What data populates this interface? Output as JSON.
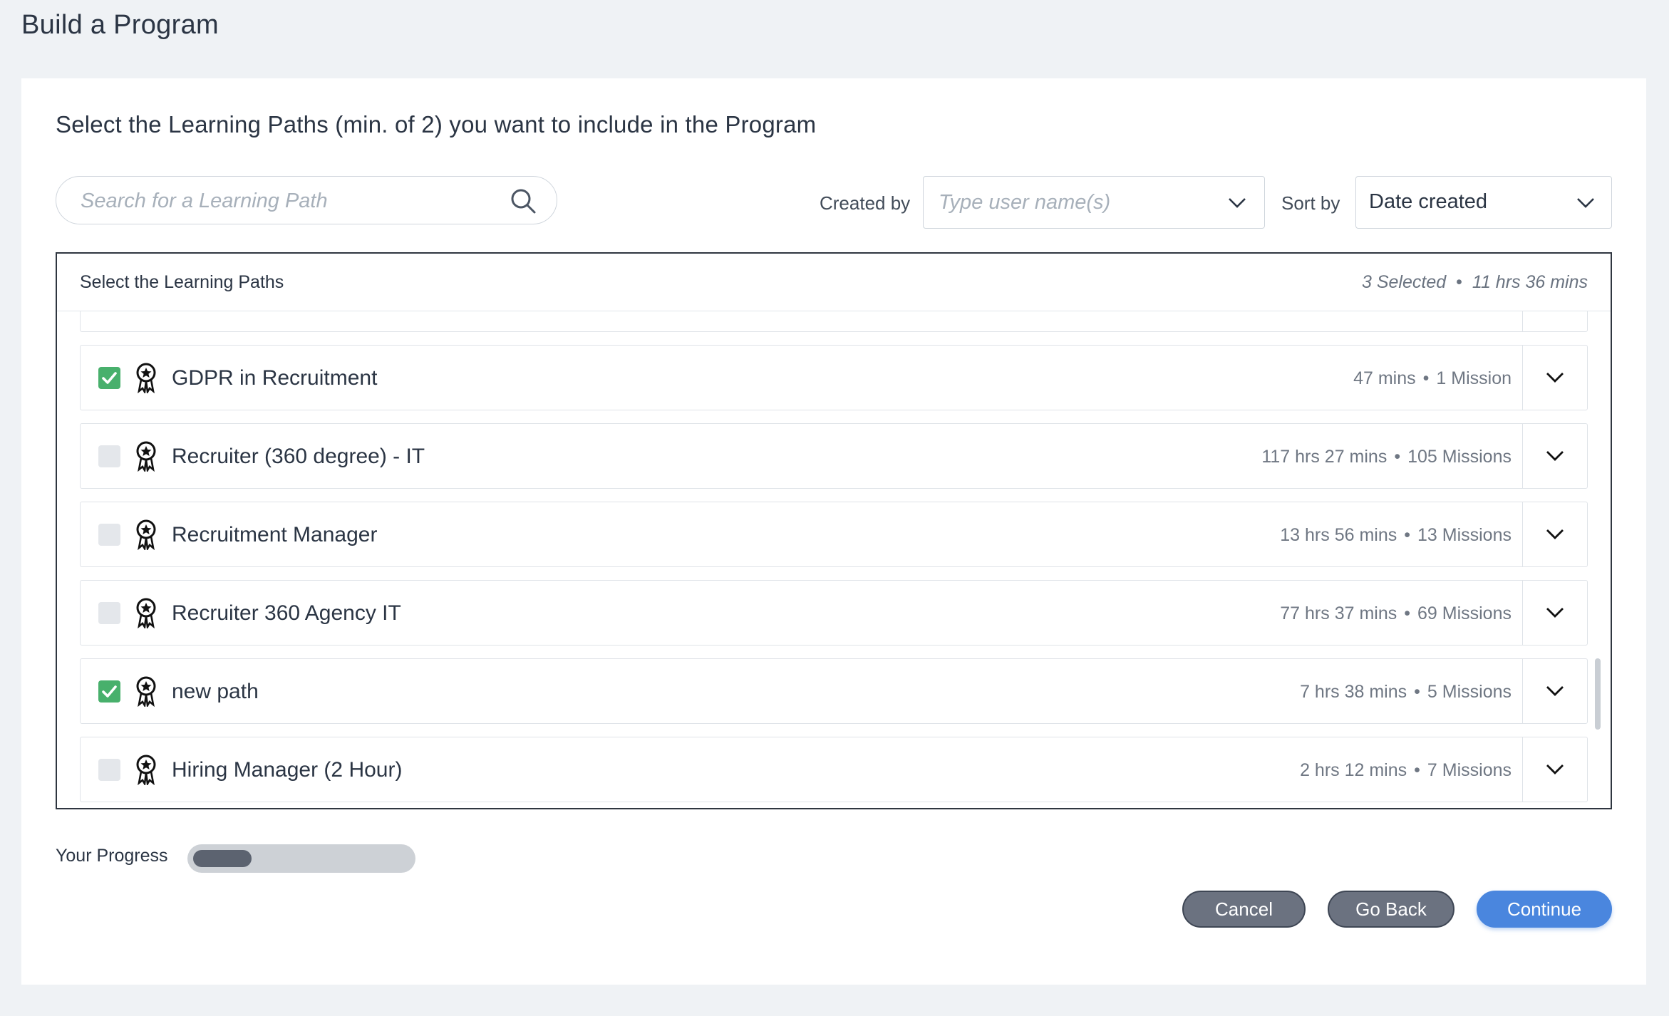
{
  "page": {
    "title": "Build a Program"
  },
  "card": {
    "instructions": "Select the Learning Paths (min. of 2) you want to include in the Program"
  },
  "filters": {
    "search_placeholder": "Search for a Learning Path",
    "created_by_label": "Created by",
    "created_by_placeholder": "Type user name(s)",
    "sort_by_label": "Sort by",
    "sort_by_value": "Date created"
  },
  "panel": {
    "title": "Select the Learning Paths",
    "selected_count": "3 Selected",
    "dot": "•",
    "total_time": "11 hrs 36 mins"
  },
  "paths": [
    {
      "name": "GDPR in Recruitment",
      "duration": "47 mins",
      "missions": "1 Mission",
      "checked": true
    },
    {
      "name": "Recruiter (360 degree) - IT",
      "duration": "117 hrs 27 mins",
      "missions": "105 Missions",
      "checked": false
    },
    {
      "name": "Recruitment Manager",
      "duration": "13 hrs 56 mins",
      "missions": "13 Missions",
      "checked": false
    },
    {
      "name": "Recruiter 360 Agency IT",
      "duration": "77 hrs 37 mins",
      "missions": "69 Missions",
      "checked": false
    },
    {
      "name": "new path",
      "duration": "7 hrs 38 mins",
      "missions": "5 Missions",
      "checked": true
    },
    {
      "name": "Hiring Manager (2 Hour)",
      "duration": "2 hrs 12 mins",
      "missions": "7 Missions",
      "checked": false
    }
  ],
  "meta_separator": "•",
  "progress": {
    "label": "Your Progress",
    "fraction": 0.27
  },
  "actions": {
    "cancel": "Cancel",
    "go_back": "Go Back",
    "continue": "Continue"
  },
  "colors": {
    "checked": "#48b06c",
    "unchecked": "#e4e7eb",
    "primary": "#4a86de",
    "secondary": "#6b7280"
  },
  "icons": {
    "search": "search-icon",
    "chevron": "chevron-down-icon",
    "badge": "award-badge-icon",
    "check": "check-icon"
  }
}
